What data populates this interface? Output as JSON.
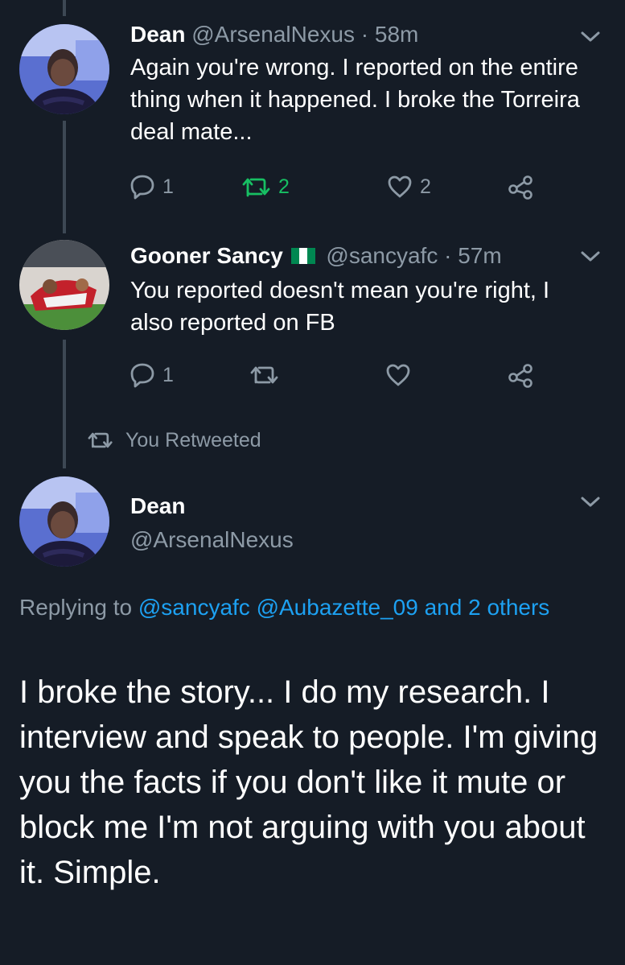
{
  "tweets": [
    {
      "name": "Dean",
      "handle": "@ArsenalNexus",
      "separator": "·",
      "time": "58m",
      "text": "Again you're wrong. I reported on the entire thing when it happened. I broke the Torreira deal mate...",
      "replies": "1",
      "retweets": "2",
      "likes": "2",
      "retweeted": true
    },
    {
      "name": "Gooner Sancy",
      "handle": "@sancyafc",
      "separator": "·",
      "time": "57m",
      "text": "You reported doesn't mean you're right, I also reported on FB",
      "replies": "1",
      "retweets": "",
      "likes": "",
      "retweeted": false,
      "flag_colors": [
        "#008751",
        "#ffffff",
        "#008751"
      ]
    }
  ],
  "retweet_context": "You Retweeted",
  "main_tweet": {
    "name": "Dean",
    "handle": "@ArsenalNexus",
    "replying_prefix": "Replying to",
    "mention_1": "@sancyafc",
    "mention_2": "@Aubazette_09",
    "and_text": "and",
    "others_text": "2 others",
    "text": "I broke the story... I do my research. I interview and speak to people. I'm giving you the facts if you don't like it mute or block me I'm not arguing with you about it. Simple."
  },
  "colors": {
    "background": "#151c26",
    "muted": "#8d9aa6",
    "link": "#1da1f2",
    "retweet_active": "#17bf63",
    "thread_line": "#3d4854"
  },
  "icons": {
    "reply": "reply-icon",
    "retweet": "retweet-icon",
    "like": "heart-icon",
    "share": "share-icon",
    "more": "chevron-down-icon"
  }
}
